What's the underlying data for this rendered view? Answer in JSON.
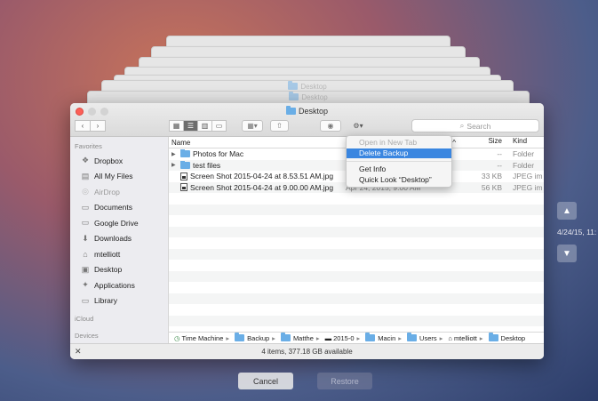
{
  "window": {
    "title": "Desktop",
    "background_titles": [
      "Desktop",
      "Desktop"
    ]
  },
  "toolbar": {
    "search_placeholder": "Search",
    "gear": "⚙▾"
  },
  "sidebar": {
    "favorites_header": "Favorites",
    "favorites": [
      {
        "label": "Dropbox",
        "icon": "dropbox-icon"
      },
      {
        "label": "All My Files",
        "icon": "all-files-icon"
      },
      {
        "label": "AirDrop",
        "icon": "airdrop-icon"
      },
      {
        "label": "Documents",
        "icon": "documents-icon"
      },
      {
        "label": "Google Drive",
        "icon": "google-drive-icon"
      },
      {
        "label": "Downloads",
        "icon": "downloads-icon"
      },
      {
        "label": "mtelliott",
        "icon": "home-icon"
      },
      {
        "label": "Desktop",
        "icon": "desktop-icon"
      },
      {
        "label": "Applications",
        "icon": "applications-icon"
      },
      {
        "label": "Library",
        "icon": "folder-icon"
      }
    ],
    "icloud_header": "iCloud",
    "devices_header": "Devices"
  },
  "columns": {
    "name": "Name",
    "size": "Size",
    "kind": "Kind"
  },
  "files": [
    {
      "name": "Photos for Mac",
      "date": "",
      "size": "--",
      "kind": "Folder",
      "type": "folder"
    },
    {
      "name": "test files",
      "date": "",
      "size": "--",
      "kind": "Folder",
      "type": "folder"
    },
    {
      "name": "Screen Shot 2015-04-24 at 8.53.51 AM.jpg",
      "date": "",
      "size": "33 KB",
      "kind": "JPEG im",
      "type": "file"
    },
    {
      "name": "Screen Shot 2015-04-24 at 9.00.00 AM.jpg",
      "date": "Apr 24, 2015, 9:00 AM",
      "size": "56 KB",
      "kind": "JPEG im",
      "type": "file"
    }
  ],
  "context_menu": {
    "items": [
      "Open in New Tab",
      "Delete Backup",
      "Get Info",
      "Quick Look “Desktop”"
    ]
  },
  "path_bar": [
    "Time Machine",
    "Backup",
    "Matthe",
    "2015-0",
    "Macin",
    "Users",
    "mtelliott",
    "Desktop"
  ],
  "status": "4 items, 377.18 GB available",
  "timeline": {
    "date": "4/24/15, 11:"
  },
  "buttons": {
    "cancel": "Cancel",
    "restore": "Restore"
  }
}
